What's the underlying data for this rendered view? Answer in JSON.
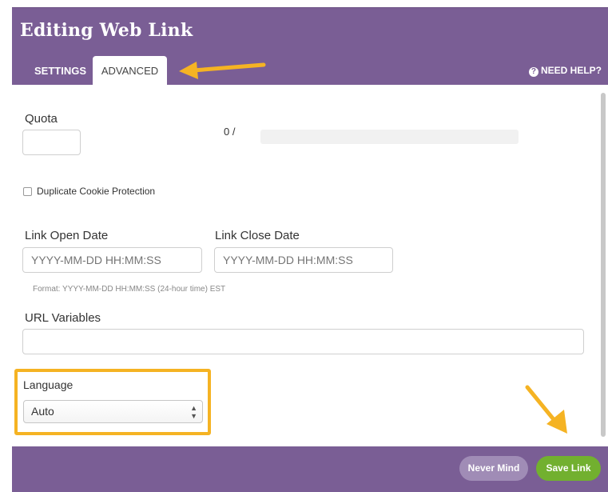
{
  "title": "Editing Web Link",
  "tabs": [
    {
      "label": "SETTINGS"
    },
    {
      "label": "ADVANCED"
    }
  ],
  "help": {
    "icon": "question-circle-icon",
    "label": "NEED HELP?",
    "glyph": "?"
  },
  "quota": {
    "label": "Quota",
    "value": "",
    "count_text": "0 /"
  },
  "duplicate_cookie": {
    "label": "Duplicate Cookie Protection",
    "checked": false
  },
  "open_date": {
    "label": "Link Open Date",
    "placeholder": "YYYY-MM-DD HH:MM:SS"
  },
  "close_date": {
    "label": "Link Close Date",
    "placeholder": "YYYY-MM-DD HH:MM:SS"
  },
  "date_format_hint": "Format: YYYY-MM-DD HH:MM:SS (24-hour time) EST",
  "url_variables": {
    "label": "URL Variables",
    "value": ""
  },
  "language": {
    "label": "Language",
    "selected": "Auto"
  },
  "footer": {
    "never_mind_label": "Never Mind",
    "save_label": "Save Link"
  },
  "colors": {
    "header": "#7a5e95",
    "highlight": "#f5b323",
    "save": "#72b02f",
    "never_mind": "#a08cb6"
  }
}
